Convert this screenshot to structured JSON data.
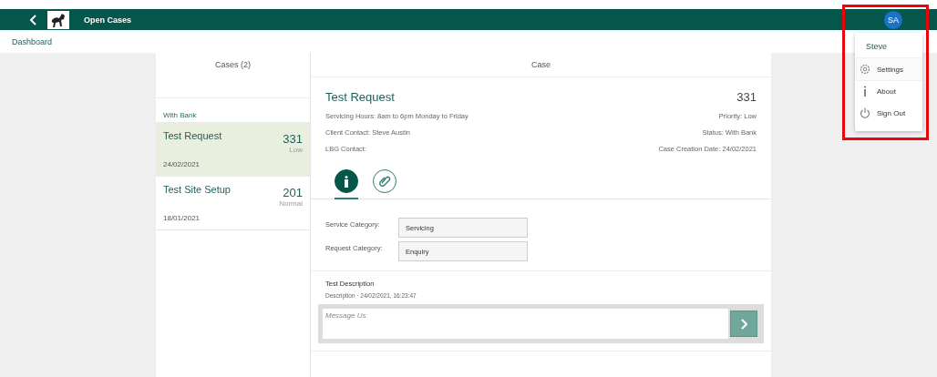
{
  "header": {
    "title": "Open Cases",
    "avatar": "SA"
  },
  "breadcrumb": "Dashboard",
  "cases": {
    "title": "Cases (2)",
    "group": "With Bank",
    "items": [
      {
        "title": "Test Request",
        "number": "331",
        "priority": "Low",
        "date": "24/02/2021",
        "selected": true
      },
      {
        "title": "Test Site Setup",
        "number": "201",
        "priority": "Normal",
        "date": "18/01/2021",
        "selected": false
      }
    ]
  },
  "case": {
    "header": "Case",
    "title": "Test Request",
    "number": "331",
    "left": [
      "Servicing Hours: 8am to 6pm Monday to Friday",
      "Client Contact: Steve Austin",
      "LBG Contact:"
    ],
    "right": [
      "Priority: Low",
      "Status: With Bank",
      "Case Creation Date: 24/02/2021"
    ],
    "tabs": [
      {
        "kind": "info",
        "selected": true
      },
      {
        "kind": "attachment",
        "selected": false
      }
    ],
    "fields": [
      {
        "label": "Service Category:",
        "value": "Servicing"
      },
      {
        "label": "Request Category:",
        "value": "Enquiry"
      }
    ],
    "message": {
      "title": "Test Description",
      "meta": "Description · 24/02/2021, 16:23:47"
    },
    "compose": {
      "placeholder": "Message Us"
    }
  },
  "user_menu": {
    "name": "Steve",
    "items": [
      {
        "kind": "settings",
        "label": "Settings",
        "selected": true
      },
      {
        "kind": "about",
        "label": "About",
        "selected": false
      },
      {
        "kind": "signout",
        "label": "Sign Out",
        "selected": false
      }
    ]
  }
}
